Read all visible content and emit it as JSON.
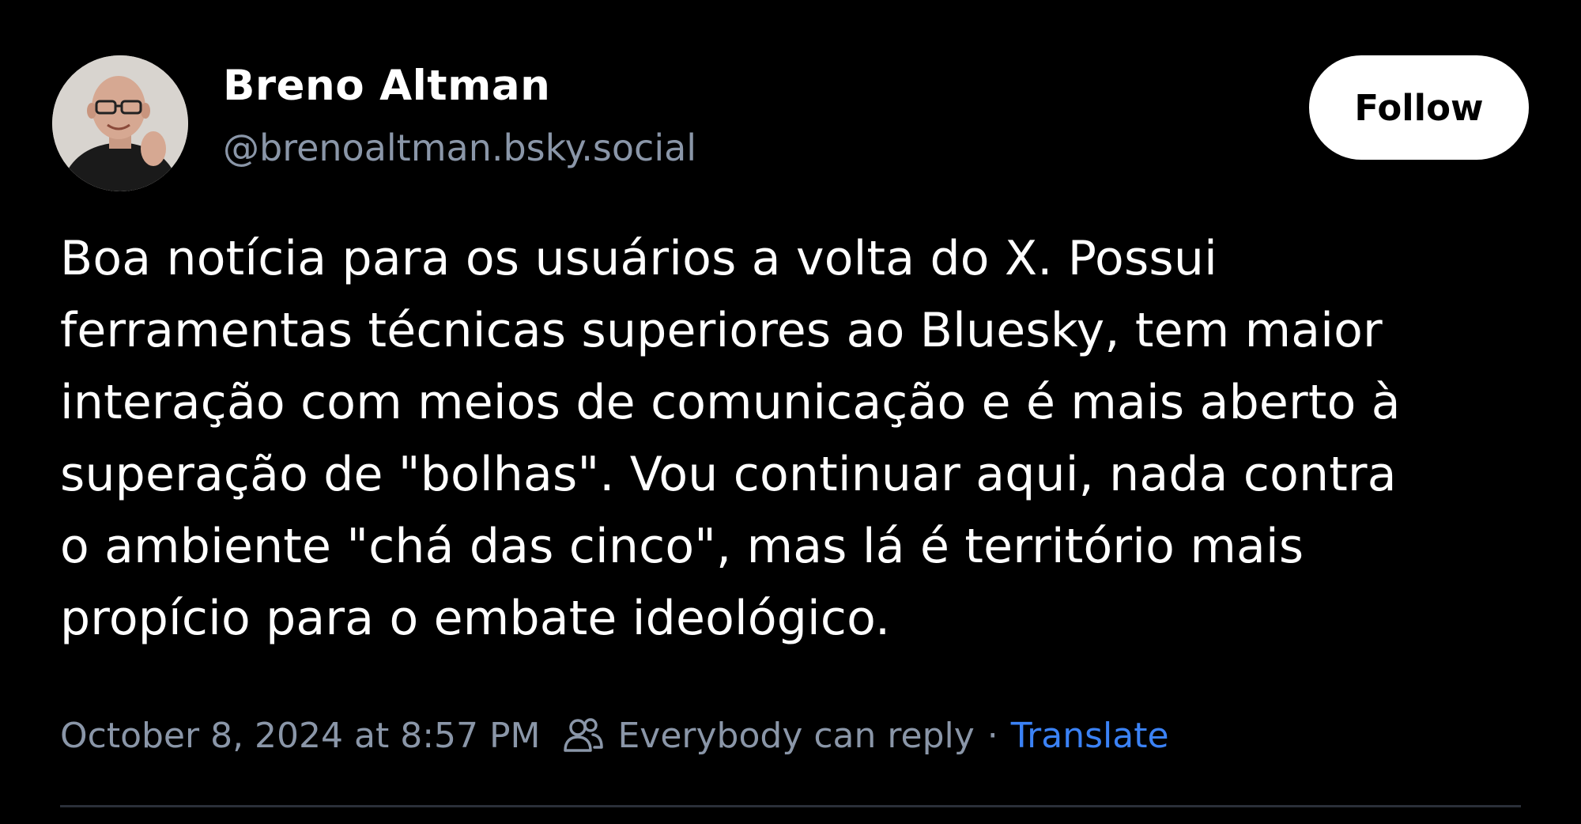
{
  "post": {
    "author": {
      "display_name": "Breno Altman",
      "handle": "@brenoaltman.bsky.social"
    },
    "follow_label": "Follow",
    "text": "Boa notícia para os usuários a volta do X. Possui\nferramentas técnicas superiores ao Bluesky, tem maior\ninteração com meios de comunicação e é mais aberto à\nsuperação de \"bolhas\". Vou continuar aqui, nada contra\no ambiente \"chá das cinco\", mas lá é território mais\npropício para o embate ideológico.",
    "timestamp": "October 8, 2024 at 8:57 PM",
    "reply_setting": "Everybody can reply",
    "separator": "·",
    "translate_label": "Translate",
    "icons": {
      "reply_setting": "people-icon"
    },
    "colors": {
      "background": "#000000",
      "secondary_text": "#8a96a8",
      "link": "#3b82f6"
    }
  }
}
